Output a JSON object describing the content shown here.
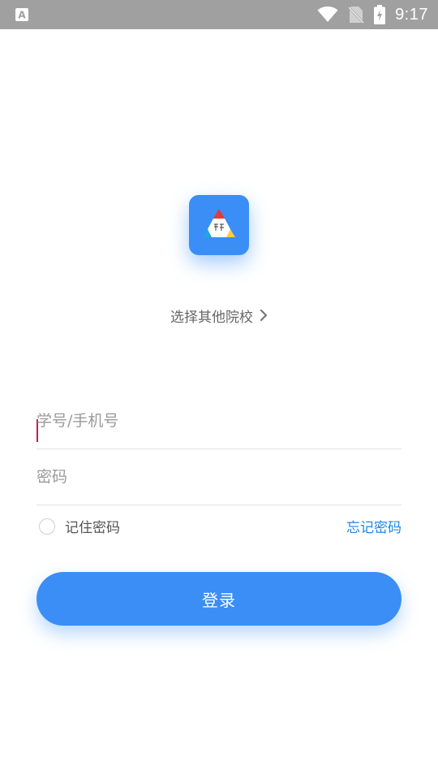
{
  "status_bar": {
    "time": "9:17",
    "left_icon": "text-a-notification-icon",
    "icons": [
      "wifi-icon",
      "no-sim-icon",
      "battery-charging-icon"
    ]
  },
  "logo": {
    "icon": "app-logo-triangle-icon"
  },
  "school_select": {
    "label": "选择其他院校",
    "icon": "chevron-right-icon"
  },
  "form": {
    "account": {
      "placeholder": "学号/手机号",
      "value": ""
    },
    "password": {
      "placeholder": "密码",
      "value": ""
    },
    "remember_label": "记住密码",
    "remember_checked": false,
    "forgot_label": "忘记密码",
    "login_label": "登录"
  },
  "colors": {
    "primary": "#3a8ef6",
    "link": "#1e88e5",
    "caret": "#c2185b",
    "status_bar": "#a0a0a0"
  }
}
